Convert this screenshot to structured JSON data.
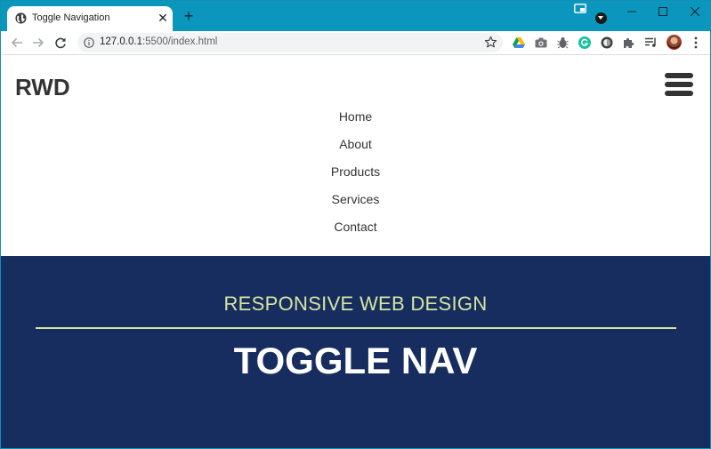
{
  "browser": {
    "tab_title": "Toggle Navigation",
    "tab_close": "✕",
    "new_tab": "+",
    "url_host": "127.0.0.1",
    "url_rest": ":5500/index.html",
    "icons": [
      "globe-icon",
      "back-arrow-icon",
      "forward-arrow-icon",
      "reload-icon",
      "info-icon",
      "star-icon",
      "google-drive-icon",
      "camera-icon",
      "bug-icon",
      "grammarly-icon",
      "circle-extension-icon",
      "puzzle-icon",
      "reading-list-icon",
      "avatar",
      "more-vert-icon",
      "minimize-icon",
      "maximize-icon",
      "close-icon"
    ],
    "colors": {
      "tabstrip": "#0b97bd",
      "omnibox": "#f1f3f4"
    }
  },
  "site": {
    "brand": "RWD",
    "menu": [
      "Home",
      "About",
      "Products",
      "Services",
      "Contact"
    ],
    "hero_subtitle": "RESPONSIVE WEB DESIGN",
    "hero_title": "TOGGLE NAV",
    "colors": {
      "hero_bg": "#182d5f",
      "accent": "#d4e6a0",
      "text": "#333333"
    }
  }
}
